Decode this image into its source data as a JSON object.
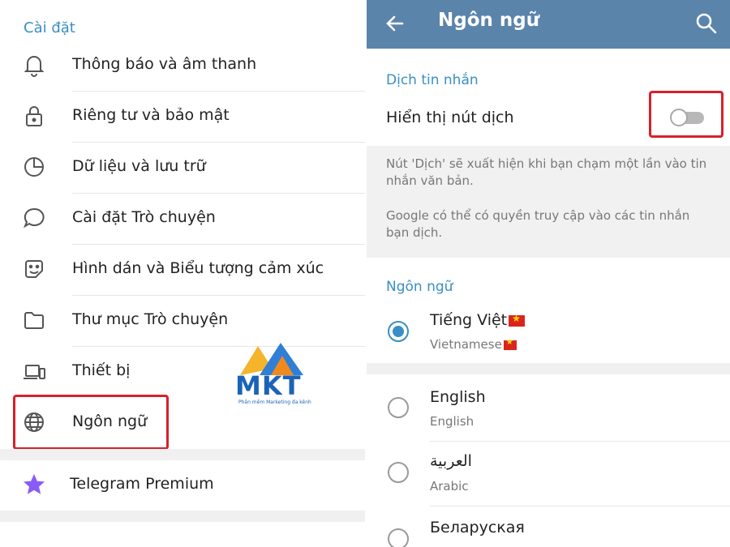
{
  "left": {
    "section_title": "Cài đặt",
    "items": [
      {
        "label": "Thông báo và âm thanh",
        "icon": "bell-icon"
      },
      {
        "label": "Riêng tư và bảo mật",
        "icon": "lock-icon"
      },
      {
        "label": "Dữ liệu và lưu trữ",
        "icon": "pie-chart-icon"
      },
      {
        "label": "Cài đặt Trò chuyện",
        "icon": "chat-bubble-icon"
      },
      {
        "label": "Hình dán và Biểu tượng cảm xúc",
        "icon": "sticker-icon"
      },
      {
        "label": "Thư mục Trò chuyện",
        "icon": "folder-icon"
      },
      {
        "label": "Thiết bị",
        "icon": "devices-icon"
      },
      {
        "label": "Ngôn ngữ",
        "icon": "globe-icon"
      }
    ],
    "premium_label": "Telegram Premium"
  },
  "right": {
    "title": "Ngôn ngữ",
    "translate_section": "Dịch tin nhắn",
    "toggle_label": "Hiển thị nút dịch",
    "toggle_on": false,
    "info1": "Nút 'Dịch' sẽ xuất hiện khi bạn chạm một lần vào tin nhắn văn bản.",
    "info2": "Google có thể có quyền truy cập vào các tin nhắn bạn dịch.",
    "language_section": "Ngôn ngữ",
    "languages": [
      {
        "name": "Tiếng Việt",
        "sub": "Vietnamese",
        "selected": true
      },
      {
        "name": "English",
        "sub": "English",
        "selected": false
      },
      {
        "name": "العربية",
        "sub": "Arabic",
        "selected": false
      },
      {
        "name": "Беларуская",
        "sub": "",
        "selected": false
      }
    ]
  },
  "logo": {
    "text": "MKT",
    "tagline": "Phần mềm Marketing đa kênh"
  },
  "colors": {
    "accent": "#3a8fc4",
    "appbar": "#5b84ab",
    "highlight": "#d8202a",
    "premium_star": "#8a5cf6"
  }
}
